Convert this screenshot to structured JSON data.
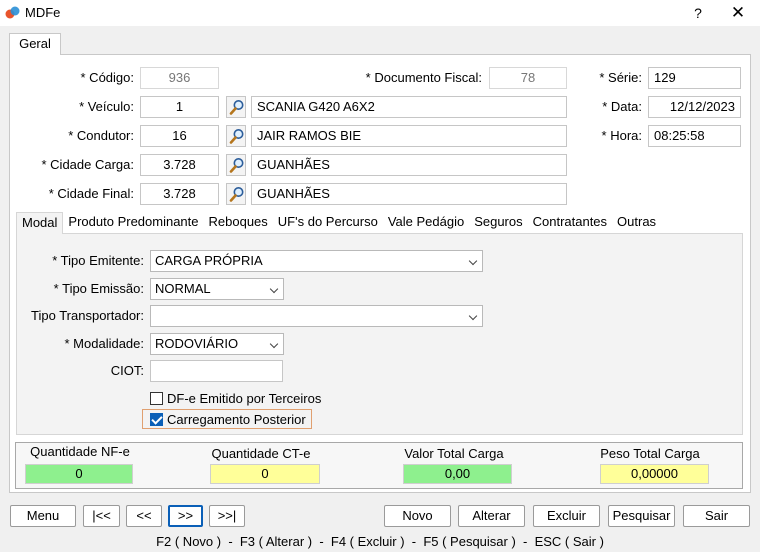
{
  "window": {
    "title": "MDFe",
    "help": "?",
    "close": "✕"
  },
  "main_tab": "Geral",
  "header": {
    "codigo": {
      "label": "* Código:",
      "value": "936"
    },
    "documento_fiscal": {
      "label": "* Documento Fiscal:",
      "value": "78"
    },
    "serie": {
      "label": "* Série:",
      "value": "129"
    },
    "veiculo": {
      "label": "* Veículo:",
      "code": "1",
      "desc": "SCANIA G420 A6X2"
    },
    "data": {
      "label": "* Data:",
      "value": "12/12/2023"
    },
    "condutor": {
      "label": "* Condutor:",
      "code": "16",
      "desc": "JAIR RAMOS BIE"
    },
    "hora": {
      "label": "* Hora:",
      "value": "08:25:58"
    },
    "cidade_carga": {
      "label": "* Cidade Carga:",
      "code": "3.728",
      "desc": "GUANHÃES"
    },
    "cidade_final": {
      "label": "* Cidade Final:",
      "code": "3.728",
      "desc": "GUANHÃES"
    }
  },
  "sub_tabs": [
    "Modal",
    "Produto Predominante",
    "Reboques",
    "UF's do Percurso",
    "Vale Pedágio",
    "Seguros",
    "Contratantes",
    "Outras"
  ],
  "modal": {
    "tipo_emitente": {
      "label": "* Tipo Emitente:",
      "value": "CARGA PRÓPRIA"
    },
    "tipo_emissao": {
      "label": "* Tipo Emissão:",
      "value": "NORMAL"
    },
    "tipo_transportador": {
      "label": "Tipo Transportador:",
      "value": ""
    },
    "modalidade": {
      "label": "* Modalidade:",
      "value": "RODOVIÁRIO"
    },
    "ciot": {
      "label": "CIOT:",
      "value": ""
    },
    "dfe_terceiros": {
      "label": "DF-e Emitido por Terceiros",
      "checked": false
    },
    "carregamento_posterior": {
      "label": "Carregamento Posterior",
      "checked": true
    }
  },
  "totals": {
    "qtd_nfe": {
      "label": "Quantidade NF-e",
      "value": "0",
      "color": "#8ef08e"
    },
    "qtd_cte": {
      "label": "Quantidade CT-e",
      "value": "0",
      "color": "#ffff99"
    },
    "valor_total": {
      "label": "Valor Total Carga",
      "value": "0,00",
      "color": "#8ef08e"
    },
    "peso_total": {
      "label": "Peso Total Carga",
      "value": "0,00000",
      "color": "#ffff99"
    }
  },
  "buttons": {
    "menu": "Menu",
    "first": "|<<",
    "prev": "<<",
    "next": ">>",
    "last": ">>|",
    "novo": "Novo",
    "alterar": "Alterar",
    "excluir": "Excluir",
    "pesquisar": "Pesquisar",
    "sair": "Sair"
  },
  "status_bar": "F2 ( Novo )  -  F3 ( Alterar )  -  F4 ( Excluir )  -  F5 ( Pesquisar )  -  ESC ( Sair )",
  "icons": {
    "app": "app-logo-icon",
    "lookup": "magnifier-icon",
    "dropdown": "chevron-down-icon"
  }
}
